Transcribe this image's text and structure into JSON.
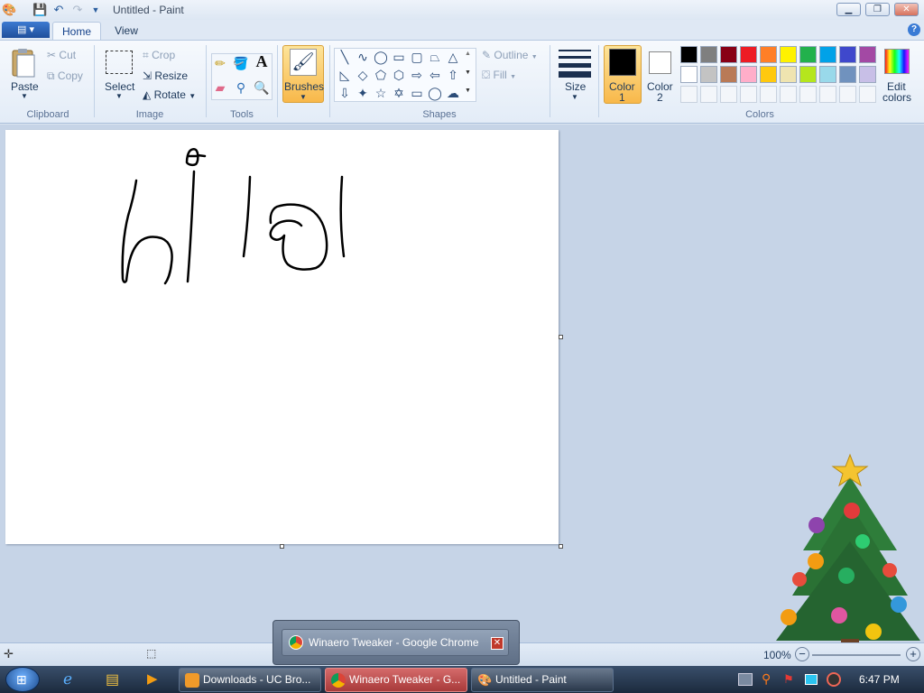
{
  "window": {
    "title": "Untitled - Paint"
  },
  "tabs": {
    "home": "Home",
    "view": "View"
  },
  "clipboard": {
    "paste": "Paste",
    "cut": "Cut",
    "copy": "Copy",
    "group": "Clipboard"
  },
  "image": {
    "select": "Select",
    "crop": "Crop",
    "resize": "Resize",
    "rotate": "Rotate",
    "group": "Image"
  },
  "tools": {
    "group": "Tools"
  },
  "brushes": {
    "label": "Brushes"
  },
  "shapes": {
    "outline": "Outline",
    "fill": "Fill",
    "group": "Shapes"
  },
  "size": {
    "label": "Size"
  },
  "colors": {
    "color1_line1": "Color",
    "color1_line2": "1",
    "color2_line1": "Color",
    "color2_line2": "2",
    "edit_line1": "Edit",
    "edit_line2": "colors",
    "group": "Colors",
    "color1": "#000000",
    "color2": "#ffffff",
    "palette_row1": [
      "#000000",
      "#7f7f7f",
      "#880015",
      "#ed1c24",
      "#ff7f27",
      "#fff200",
      "#22b14c",
      "#00a2e8",
      "#3f48cc",
      "#a349a4"
    ],
    "palette_row2": [
      "#ffffff",
      "#c3c3c3",
      "#b97a57",
      "#ffaec9",
      "#ffc90e",
      "#efe4b0",
      "#b5e61d",
      "#99d9ea",
      "#7092be",
      "#c8bfe7"
    ]
  },
  "status": {
    "zoom": "100%"
  },
  "taskbar": {
    "items": [
      "Downloads - UC Bro...",
      "Winaero Tweaker - G...",
      "Untitled - Paint"
    ],
    "clock": "6:47 PM",
    "thumbnail_title": "Winaero Tweaker - Google Chrome"
  }
}
